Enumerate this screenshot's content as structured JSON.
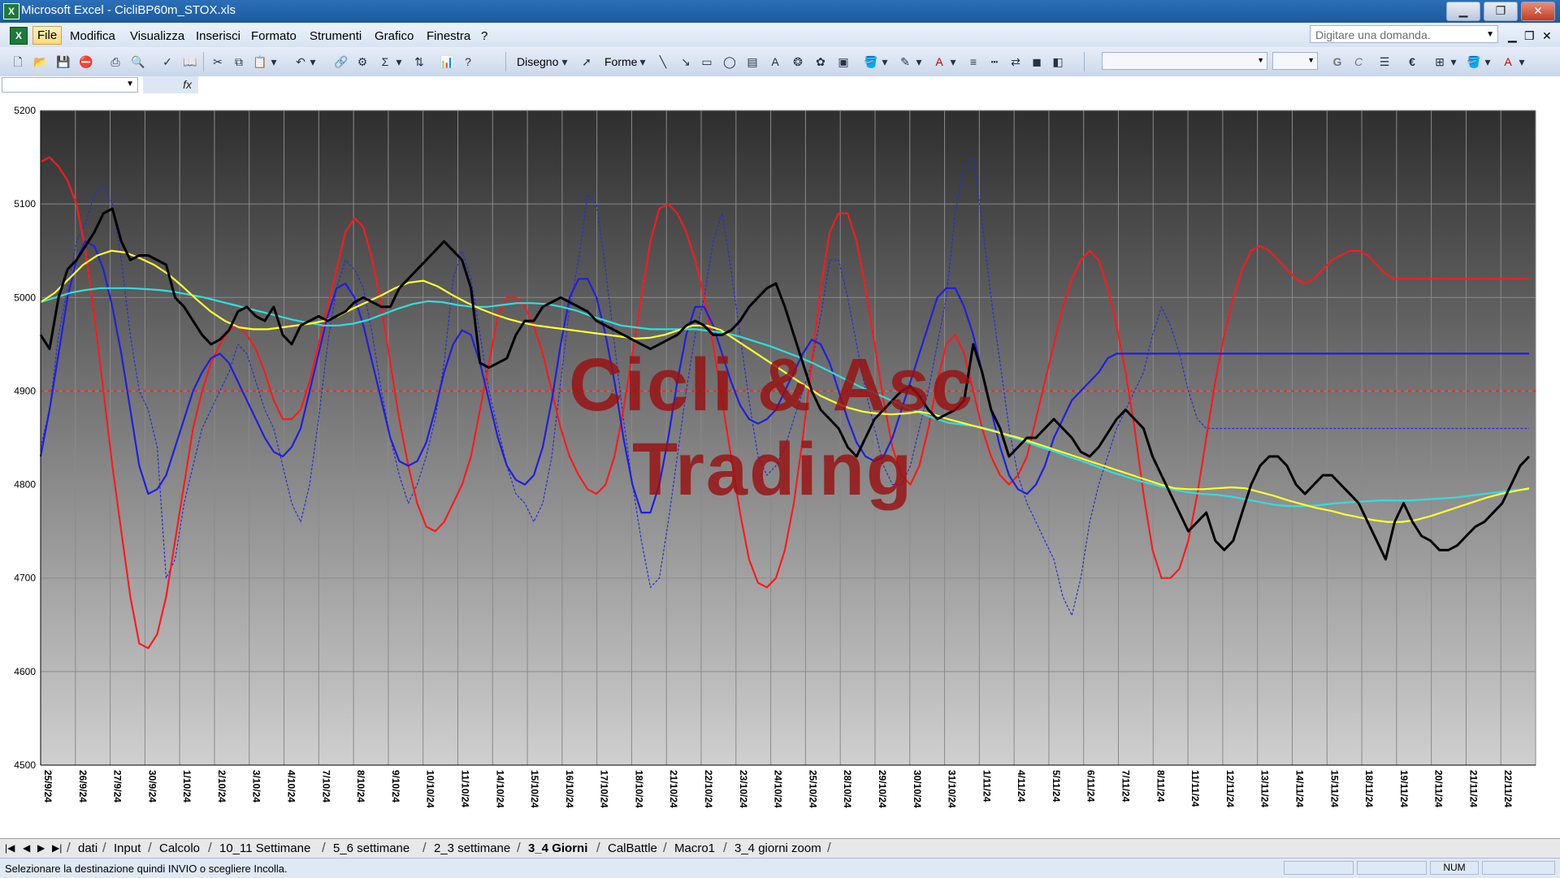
{
  "window": {
    "title": "Microsoft Excel - CicliBP60m_STOX.xls",
    "app_icon": "excel-icon",
    "minimize_label": "▁",
    "restore_label": "❐",
    "close_label": "✕"
  },
  "menu": {
    "items": [
      "File",
      "Modifica",
      "Visualizza",
      "Inserisci",
      "Formato",
      "Strumenti",
      "Grafico",
      "Finestra",
      "?"
    ],
    "ask_placeholder": "Digitare una domanda.",
    "doc_minimize": "▁",
    "doc_restore": "❐",
    "doc_close": "✕"
  },
  "toolbar": {
    "disegno_label": "Disegno",
    "forme_label": "Forme",
    "bold_label": "G",
    "italic_label": "C",
    "euro_label": "€"
  },
  "formula": {
    "fx_label": "fx"
  },
  "chart": {
    "watermark_line1": "Cicli & Asc",
    "watermark_line2": "Trading",
    "colors": {
      "plot_top": "#2e2e2e",
      "plot_bottom": "#d0d0d0",
      "price": "#000000",
      "red_oscillator": "#ff1a1a",
      "blue_oscillator": "#1f1fe0",
      "blue_dashed": "#2a2ad8",
      "yellow_ma": "#ffff33",
      "cyan_ma": "#33dddd",
      "ref_line": "#ff2020"
    }
  },
  "chart_data": {
    "type": "line",
    "title": "",
    "xlabel": "",
    "ylabel": "",
    "ylim": [
      4500,
      5200
    ],
    "yticks": [
      4500,
      4600,
      4700,
      4800,
      4900,
      5000,
      5100,
      5200
    ],
    "reference_line": 4900,
    "grid": true,
    "x_tick_labels": [
      "25/9/24",
      "26/9/24",
      "27/9/24",
      "30/9/24",
      "1/10/24",
      "2/10/24",
      "3/10/24",
      "4/10/24",
      "7/10/24",
      "8/10/24",
      "9/10/24",
      "10/10/24",
      "11/10/24",
      "14/10/24",
      "15/10/24",
      "16/10/24",
      "17/10/24",
      "18/10/24",
      "21/10/24",
      "22/10/24",
      "23/10/24",
      "24/10/24",
      "25/10/24",
      "28/10/24",
      "29/10/24",
      "30/10/24",
      "31/10/24",
      "1/11/24",
      "4/11/24",
      "5/11/24",
      "6/11/24",
      "7/11/24",
      "8/11/24",
      "11/11/24",
      "12/11/24",
      "13/11/24",
      "14/11/24",
      "15/11/24",
      "18/11/24",
      "19/11/24",
      "20/11/24",
      "21/11/24",
      "22/11/24"
    ],
    "series": [
      {
        "style": "solid-thick",
        "color": "#000000",
        "values": [
          4960,
          4945,
          5000,
          5030,
          5040,
          5055,
          5070,
          5090,
          5095,
          5060,
          5040,
          5045,
          5045,
          5040,
          5035,
          5000,
          4990,
          4975,
          4960,
          4950,
          4955,
          4965,
          4985,
          4990,
          4980,
          4975,
          4990,
          4960,
          4950,
          4970,
          4975,
          4980,
          4975,
          4980,
          4985,
          4995,
          5000,
          4995,
          4990,
          4990,
          5010,
          5020,
          5030,
          5040,
          5050,
          5060,
          5050,
          5040,
          5010,
          4930,
          4925,
          4930,
          4935,
          4960,
          4975,
          4975,
          4990,
          4995,
          5000,
          4995,
          4990,
          4985,
          4975,
          4970,
          4965,
          4960,
          4955,
          4950,
          4945,
          4950,
          4955,
          4960,
          4970,
          4975,
          4970,
          4960,
          4960,
          4965,
          4975,
          4990,
          5000,
          5010,
          5015,
          4990,
          4960,
          4930,
          4900,
          4880,
          4870,
          4860,
          4840,
          4830,
          4850,
          4870,
          4880,
          4890,
          4900,
          4905,
          4895,
          4880,
          4870,
          4875,
          4880,
          4890,
          4950,
          4920,
          4880,
          4860,
          4830,
          4840,
          4850,
          4850,
          4860,
          4870,
          4860,
          4850,
          4835,
          4830,
          4840,
          4855,
          4870,
          4880,
          4870,
          4860,
          4830,
          4810,
          4790,
          4770,
          4750,
          4760,
          4770,
          4740,
          4730,
          4740,
          4770,
          4800,
          4820,
          4830,
          4830,
          4820,
          4800,
          4790,
          4800,
          4810,
          4810,
          4800,
          4790,
          4780,
          4760,
          4740,
          4720,
          4760,
          4780,
          4760,
          4745,
          4740,
          4730,
          4730,
          4735,
          4745,
          4755,
          4760,
          4770,
          4780,
          4800,
          4820,
          4830
        ]
      },
      {
        "style": "solid",
        "color": "#ff1a1a",
        "values": [
          5145,
          5150,
          5140,
          5125,
          5100,
          5050,
          4980,
          4900,
          4820,
          4750,
          4680,
          4630,
          4625,
          4640,
          4680,
          4740,
          4800,
          4860,
          4900,
          4930,
          4950,
          4965,
          4970,
          4960,
          4945,
          4920,
          4890,
          4870,
          4870,
          4880,
          4910,
          4950,
          4990,
          5030,
          5070,
          5085,
          5075,
          5040,
          4990,
          4930,
          4870,
          4820,
          4780,
          4755,
          4750,
          4760,
          4780,
          4800,
          4830,
          4880,
          4930,
          4980,
          5000,
          5000,
          4990,
          4970,
          4940,
          4900,
          4860,
          4830,
          4810,
          4795,
          4790,
          4800,
          4830,
          4880,
          4940,
          5000,
          5060,
          5095,
          5100,
          5090,
          5070,
          5040,
          5000,
          4950,
          4890,
          4830,
          4770,
          4720,
          4695,
          4690,
          4700,
          4730,
          4780,
          4850,
          4930,
          5010,
          5070,
          5090,
          5090,
          5060,
          5010,
          4950,
          4890,
          4840,
          4810,
          4800,
          4820,
          4860,
          4910,
          4950,
          4960,
          4940,
          4900,
          4860,
          4830,
          4810,
          4800,
          4810,
          4830,
          4870,
          4910,
          4950,
          4990,
          5020,
          5040,
          5050,
          5040,
          5010,
          4970,
          4920,
          4860,
          4790,
          4730,
          4700,
          4700,
          4710,
          4740,
          4790,
          4850,
          4910,
          4960,
          5000,
          5030,
          5050,
          5055,
          5050,
          5040,
          5030,
          5020,
          5015,
          5020,
          5030,
          5040,
          5045,
          5050,
          5050,
          5045,
          5035,
          5025,
          5020,
          5020,
          5020,
          5020,
          5020,
          5020,
          5020,
          5020,
          5020,
          5020,
          5020,
          5020,
          5020,
          5020,
          5020,
          5020
        ]
      },
      {
        "style": "solid",
        "color": "#1f1fe0",
        "values": [
          4830,
          4880,
          4940,
          5000,
          5040,
          5060,
          5055,
          5030,
          4990,
          4940,
          4880,
          4820,
          4790,
          4795,
          4810,
          4840,
          4870,
          4900,
          4920,
          4935,
          4940,
          4930,
          4910,
          4890,
          4870,
          4850,
          4835,
          4830,
          4840,
          4860,
          4900,
          4940,
          4980,
          5010,
          5015,
          5000,
          4970,
          4930,
          4890,
          4850,
          4825,
          4820,
          4825,
          4845,
          4880,
          4920,
          4950,
          4965,
          4960,
          4930,
          4890,
          4850,
          4820,
          4805,
          4800,
          4810,
          4840,
          4890,
          4950,
          5000,
          5020,
          5020,
          5000,
          4960,
          4910,
          4850,
          4800,
          4770,
          4770,
          4800,
          4850,
          4910,
          4960,
          4990,
          4990,
          4970,
          4940,
          4910,
          4885,
          4870,
          4865,
          4870,
          4880,
          4900,
          4920,
          4940,
          4955,
          4950,
          4930,
          4900,
          4870,
          4845,
          4830,
          4825,
          4830,
          4850,
          4880,
          4910,
          4940,
          4970,
          5000,
          5010,
          5010,
          4990,
          4960,
          4920,
          4880,
          4840,
          4810,
          4795,
          4790,
          4800,
          4820,
          4850,
          4870,
          4890,
          4900,
          4910,
          4920,
          4935,
          4940,
          4940,
          4940,
          4940,
          4940,
          4940,
          4940,
          4940,
          4940,
          4940,
          4940,
          4940,
          4940,
          4940,
          4940,
          4940,
          4940,
          4940,
          4940,
          4940,
          4940,
          4940,
          4940,
          4940,
          4940,
          4940,
          4940,
          4940,
          4940,
          4940,
          4940,
          4940,
          4940,
          4940,
          4940,
          4940,
          4940,
          4940,
          4940,
          4940,
          4940,
          4940,
          4940,
          4940,
          4940,
          4940,
          4940
        ]
      },
      {
        "style": "dashed",
        "color": "#2a2ad8",
        "values": [
          4840,
          4880,
          4960,
          5010,
          5060,
          5080,
          5110,
          5120,
          5100,
          5040,
          4960,
          4900,
          4880,
          4840,
          4700,
          4720,
          4780,
          4820,
          4860,
          4880,
          4900,
          4920,
          4950,
          4940,
          4910,
          4880,
          4860,
          4820,
          4780,
          4760,
          4800,
          4870,
          4950,
          5010,
          5040,
          5030,
          5010,
          4960,
          4900,
          4850,
          4810,
          4780,
          4800,
          4830,
          4870,
          4930,
          5020,
          5050,
          5020,
          4960,
          4900,
          4860,
          4820,
          4790,
          4780,
          4760,
          4780,
          4830,
          4910,
          4990,
          5040,
          5110,
          5100,
          5030,
          4950,
          4870,
          4800,
          4740,
          4690,
          4700,
          4760,
          4830,
          4900,
          4960,
          5000,
          5060,
          5090,
          5030,
          4960,
          4890,
          4830,
          4810,
          4820,
          4840,
          4870,
          4900,
          4930,
          4980,
          5040,
          5040,
          5000,
          4950,
          4900,
          4860,
          4820,
          4800,
          4800,
          4820,
          4860,
          4900,
          4950,
          5000,
          5090,
          5140,
          5150,
          5080,
          5000,
          4930,
          4860,
          4810,
          4780,
          4760,
          4740,
          4720,
          4680,
          4660,
          4700,
          4760,
          4800,
          4830,
          4860,
          4880,
          4900,
          4920,
          4960,
          4990,
          4970,
          4940,
          4900,
          4870,
          4860,
          4860,
          4860,
          4860,
          4860,
          4860,
          4860,
          4860,
          4860,
          4860,
          4860,
          4860,
          4860,
          4860,
          4860,
          4860,
          4860,
          4860,
          4860,
          4860,
          4860,
          4860,
          4860,
          4860,
          4860,
          4860,
          4860,
          4860,
          4860,
          4860,
          4860,
          4860,
          4860,
          4860,
          4860,
          4860,
          4860
        ]
      },
      {
        "style": "solid",
        "color": "#ffff33",
        "values": [
          4995,
          5005,
          5020,
          5035,
          5045,
          5050,
          5048,
          5042,
          5035,
          5025,
          5012,
          4998,
          4985,
          4975,
          4968,
          4966,
          4966,
          4968,
          4970,
          4972,
          4975,
          4980,
          4988,
          4995,
          5002,
          5010,
          5016,
          5018,
          5012,
          5003,
          4995,
          4988,
          4982,
          4977,
          4973,
          4970,
          4968,
          4966,
          4964,
          4962,
          4960,
          4958,
          4956,
          4957,
          4960,
          4965,
          4970,
          4970,
          4965,
          4955,
          4945,
          4935,
          4925,
          4915,
          4905,
          4895,
          4888,
          4882,
          4878,
          4876,
          4875,
          4876,
          4878,
          4875,
          4870,
          4866,
          4862,
          4858,
          4854,
          4850,
          4845,
          4840,
          4835,
          4830,
          4825,
          4820,
          4815,
          4810,
          4805,
          4800,
          4796,
          4795,
          4795,
          4796,
          4797,
          4796,
          4792,
          4788,
          4783,
          4779,
          4775,
          4772,
          4768,
          4765,
          4762,
          4760,
          4760,
          4762,
          4766,
          4771,
          4776,
          4781,
          4786,
          4790,
          4793,
          4796
        ]
      },
      {
        "style": "solid",
        "color": "#33dddd",
        "values": [
          4995,
          5000,
          5005,
          5008,
          5010,
          5010,
          5010,
          5009,
          5008,
          5006,
          5003,
          5000,
          4996,
          4992,
          4988,
          4984,
          4980,
          4976,
          4973,
          4970,
          4970,
          4972,
          4976,
          4982,
          4988,
          4993,
          4996,
          4995,
          4992,
          4990,
          4990,
          4992,
          4994,
          4994,
          4993,
          4990,
          4986,
          4980,
          4975,
          4970,
          4968,
          4966,
          4966,
          4966,
          4966,
          4964,
          4962,
          4958,
          4953,
          4948,
          4942,
          4936,
          4929,
          4921,
          4913,
          4905,
          4898,
          4891,
          4884,
          4877,
          4871,
          4866,
          4864,
          4862,
          4858,
          4852,
          4847,
          4841,
          4836,
          4830,
          4825,
          4819,
          4813,
          4808,
          4803,
          4799,
          4795,
          4792,
          4790,
          4789,
          4787,
          4784,
          4781,
          4778,
          4777,
          4777,
          4778,
          4780,
          4781,
          4782,
          4783,
          4783,
          4783,
          4784,
          4785,
          4786,
          4788,
          4790,
          4792,
          4794,
          4795
        ]
      }
    ]
  },
  "sheets": {
    "tabs": [
      "dati",
      "Input",
      "Calcolo",
      "10_11 Settimane",
      "5_6 settimane",
      "2_3 settimane",
      "3_4 Giorni",
      "CalBattle",
      "Macro1",
      "3_4 giorni zoom"
    ],
    "active": "3_4 Giorni"
  },
  "status": {
    "message": "Selezionare la destinazione quindi INVIO o scegliere Incolla.",
    "num_indicator": "NUM"
  }
}
